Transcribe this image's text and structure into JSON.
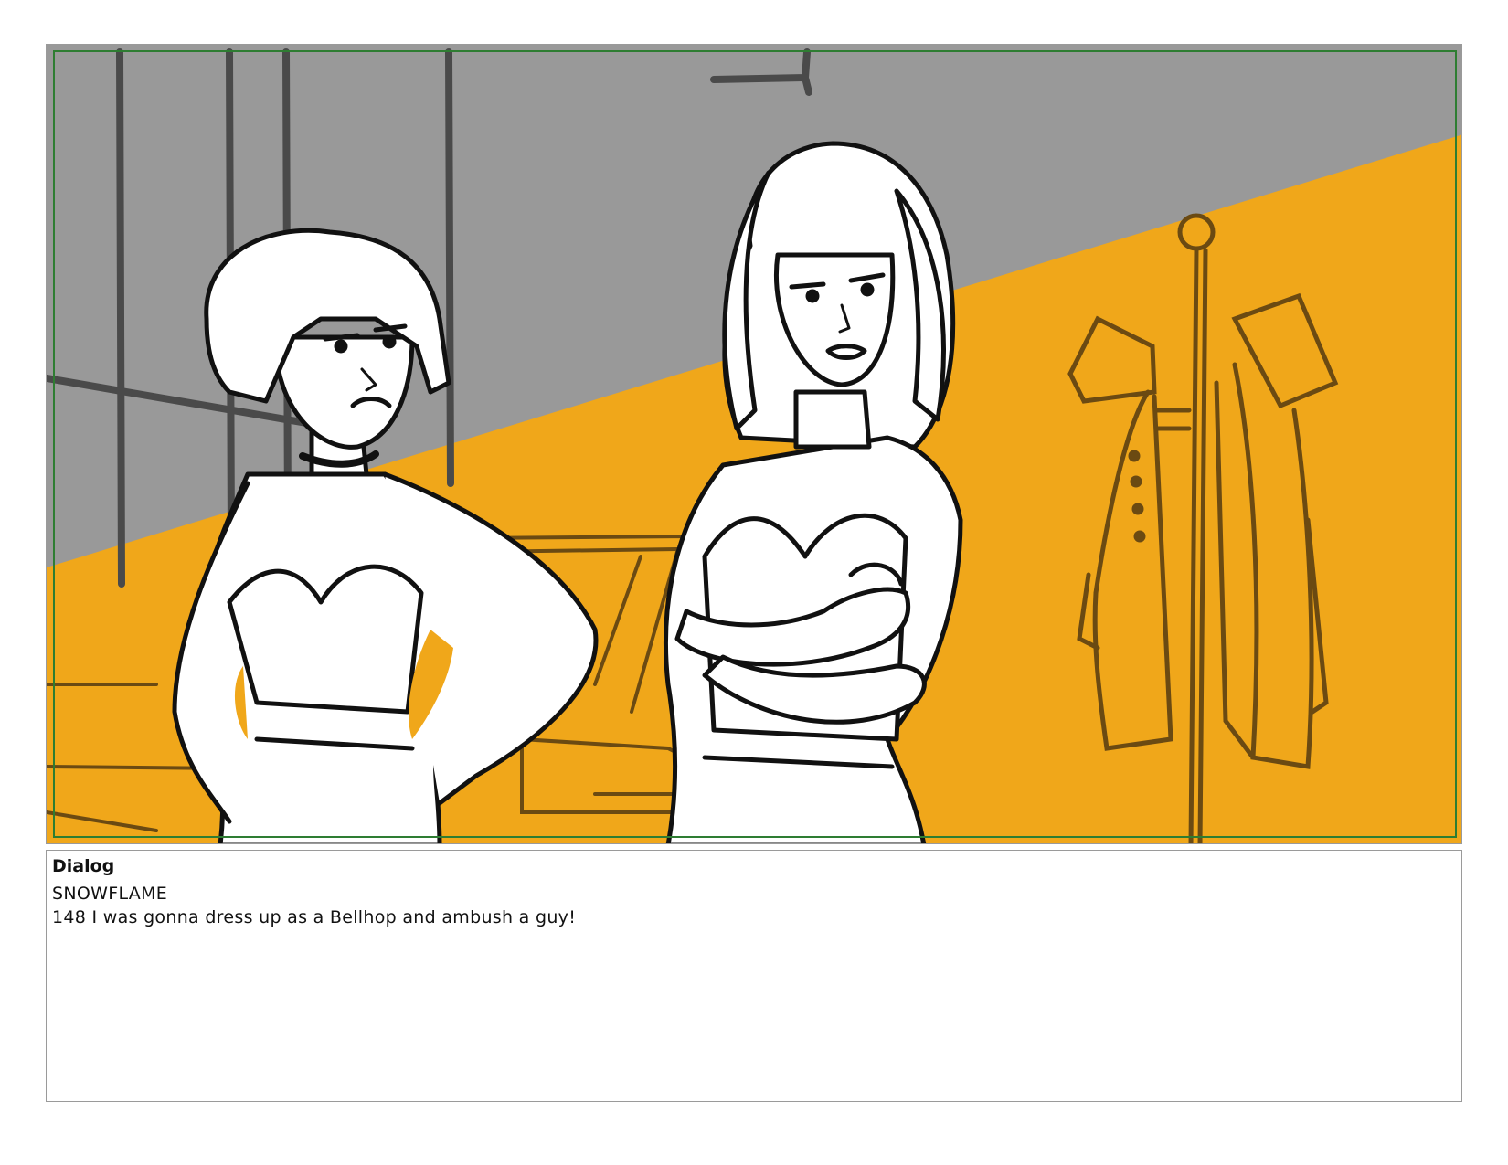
{
  "panel": {
    "art": "storyboard-sketch",
    "colors": {
      "wall": "#999999",
      "light": "#f0a71a",
      "safe_frame": "#2e7d32",
      "ink": "#111111",
      "prop_ink": "#6b4a12"
    }
  },
  "dialog": {
    "title": "Dialog",
    "character": "SNOWFLAME",
    "line": "148 I was gonna dress up as a Bellhop and ambush a guy!"
  }
}
